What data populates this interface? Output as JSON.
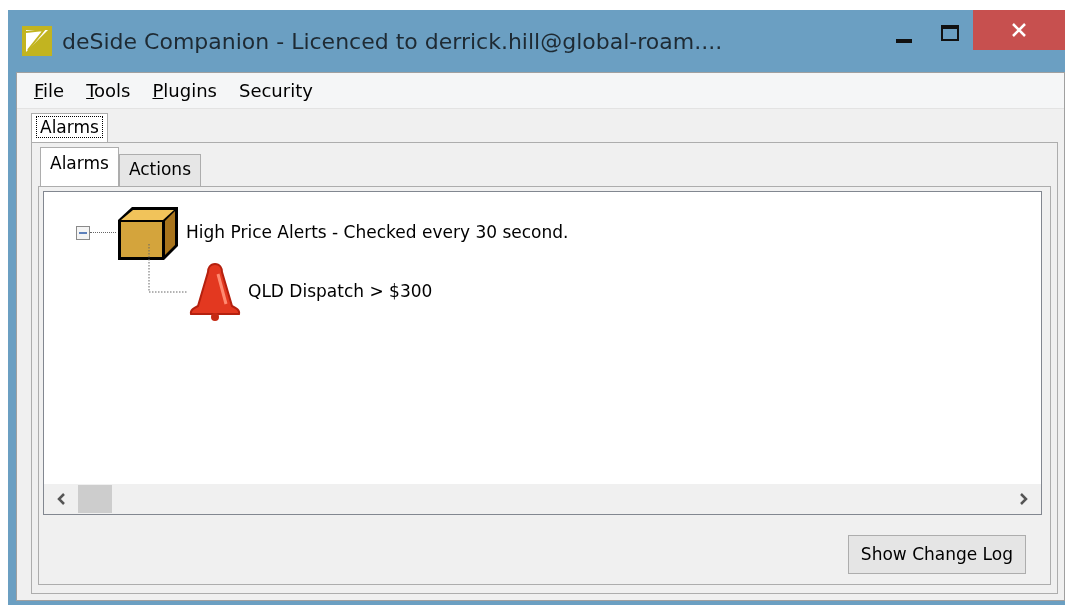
{
  "window": {
    "title": "deSide Companion - Licenced to derrick.hill@global-roam...."
  },
  "menu": [
    {
      "label": "File",
      "mnemonic_first": true
    },
    {
      "label": "Tools",
      "mnemonic_first": true
    },
    {
      "label": "Plugins",
      "mnemonic_first": true
    },
    {
      "label": "Security",
      "mnemonic_first": false
    }
  ],
  "outer_tabs": [
    {
      "label": "Alarms",
      "selected": true
    }
  ],
  "inner_tabs": [
    {
      "label": "Alarms",
      "selected": true
    },
    {
      "label": "Actions",
      "selected": false
    }
  ],
  "tree": [
    {
      "kind": "group",
      "label": "High Price Alerts - Checked every 30 second.",
      "expanded": true,
      "children": [
        {
          "kind": "alarm",
          "label": "QLD Dispatch > $300"
        }
      ]
    }
  ],
  "buttons": [
    {
      "label": "Show Change Log"
    }
  ]
}
